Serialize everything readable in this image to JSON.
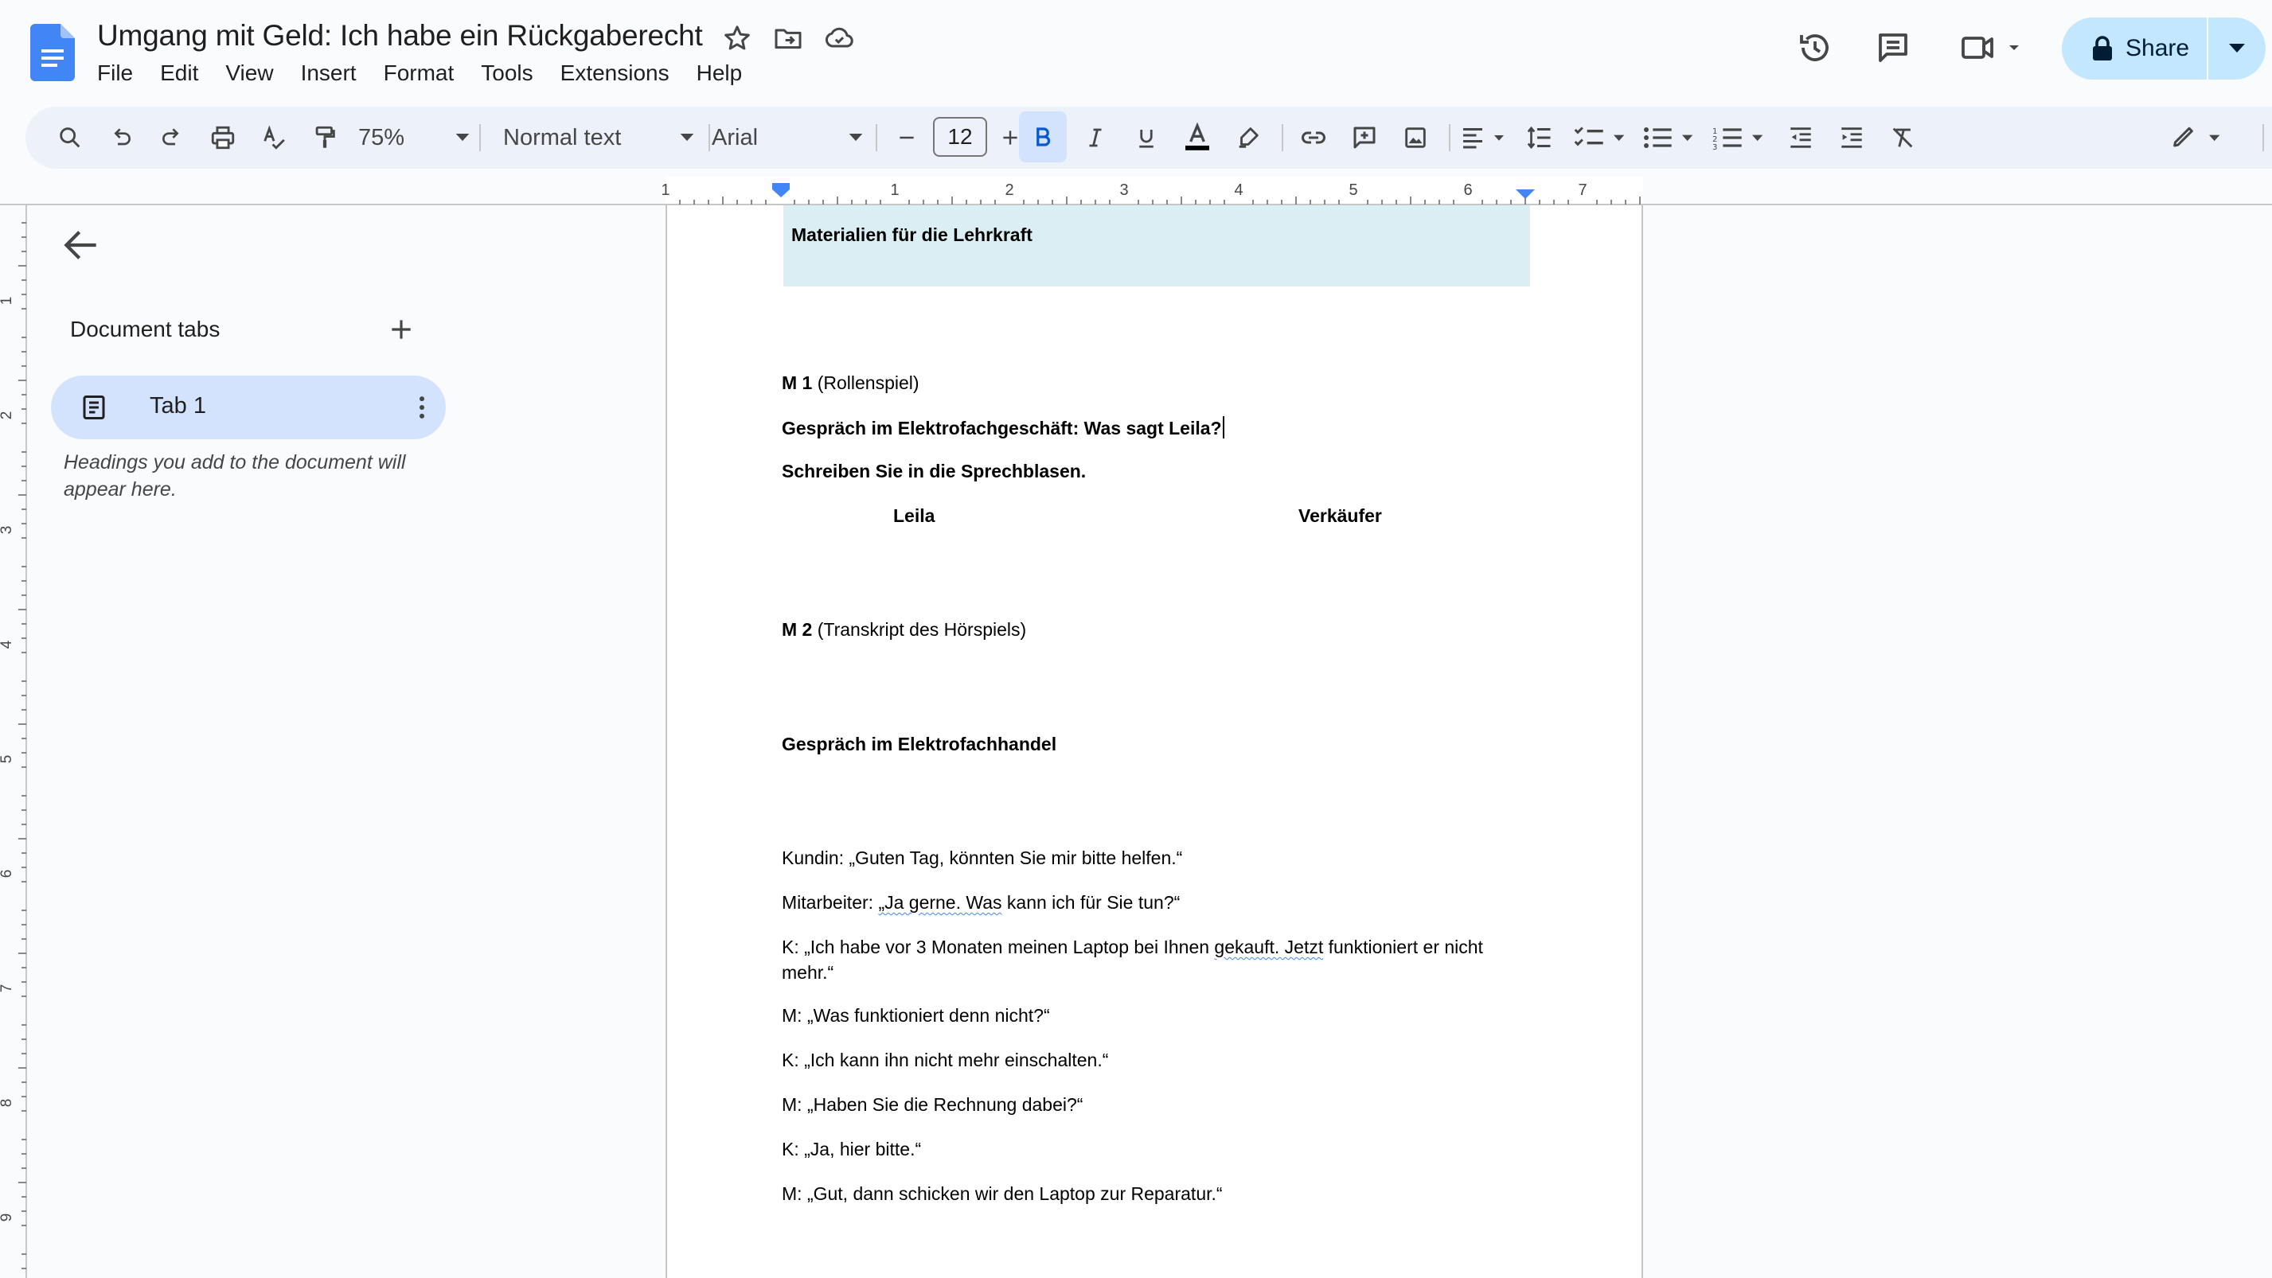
{
  "header": {
    "title": "Umgang mit Geld: Ich habe ein Rückgaberecht",
    "menu": [
      "File",
      "Edit",
      "View",
      "Insert",
      "Format",
      "Tools",
      "Extensions",
      "Help"
    ],
    "share_label": "Share"
  },
  "toolbar": {
    "zoom": "75%",
    "style": "Normal text",
    "font": "Arial",
    "font_size": "12"
  },
  "ruler": {
    "labels": [
      "1",
      "1",
      "2",
      "3",
      "4",
      "5",
      "6",
      "7"
    ],
    "vlabels": [
      "1",
      "2",
      "3",
      "4",
      "5",
      "6",
      "7",
      "8",
      "9"
    ]
  },
  "sidebar": {
    "heading": "Document tabs",
    "tab_label": "Tab 1",
    "hint": "Headings you add to the document will appear here."
  },
  "document": {
    "header_box": "Materialien für die Lehrkraft",
    "m1_bold": "M 1",
    "m1_rest": " (Rollenspiel)",
    "m1_title": "Gespräch im Elektrofachgeschäft: Was sagt Leila?",
    "m1_instruction": "Schreiben Sie in die Sprechblasen.",
    "col_left": "Leila",
    "col_right": "Verkäufer",
    "m2_bold": "M 2",
    "m2_rest": " (Transkript des Hörspiels)",
    "m2_title": "Gespräch im Elektrofachhandel",
    "line1": "Kundin: „Guten Tag, könnten Sie mir bitte helfen.“",
    "line2_a": "Mitarbeiter: ",
    "line2_b": "„Ja gerne. Was",
    "line2_c": " kann ich für Sie tun?“",
    "line3_a": "K: „Ich habe vor 3 Monaten meinen Laptop bei Ihnen ",
    "line3_b": "gekauft. Jetzt",
    "line3_c": " funktioniert er nicht",
    "line3_d": "mehr.“",
    "line4": "M: „Was funktioniert denn nicht?“",
    "line5": "K: „Ich kann ihn nicht mehr einschalten.“",
    "line6": "M: „Haben Sie die Rechnung dabei?“",
    "line7": "K: „Ja, hier bitte.“",
    "line8": "M: „Gut, dann schicken wir den Laptop zur Reparatur.“"
  },
  "colors": {
    "accent": "#0b57d0",
    "share_bg": "#c2e7ff",
    "toolbar_bg": "#edf2fa",
    "header_box_bg": "#daeef3",
    "tab_active_bg": "#d3e3fd"
  }
}
